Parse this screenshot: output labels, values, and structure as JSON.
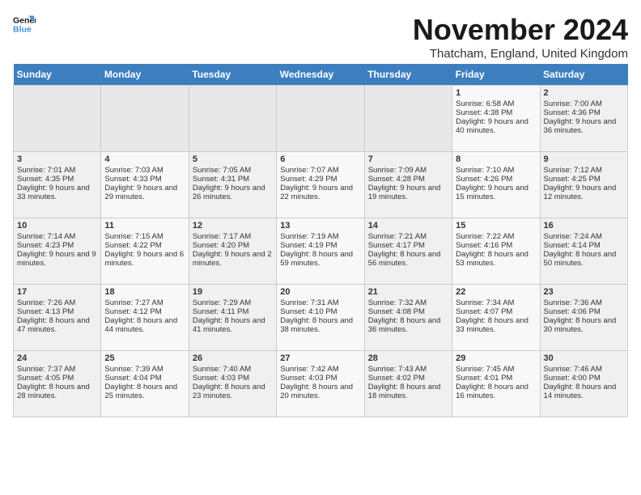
{
  "logo": {
    "line1": "General",
    "line2": "Blue"
  },
  "title": "November 2024",
  "subtitle": "Thatcham, England, United Kingdom",
  "headers": [
    "Sunday",
    "Monday",
    "Tuesday",
    "Wednesday",
    "Thursday",
    "Friday",
    "Saturday"
  ],
  "weeks": [
    [
      {
        "day": "",
        "info": ""
      },
      {
        "day": "",
        "info": ""
      },
      {
        "day": "",
        "info": ""
      },
      {
        "day": "",
        "info": ""
      },
      {
        "day": "",
        "info": ""
      },
      {
        "day": "1",
        "info": "Sunrise: 6:58 AM\nSunset: 4:38 PM\nDaylight: 9 hours and 40 minutes."
      },
      {
        "day": "2",
        "info": "Sunrise: 7:00 AM\nSunset: 4:36 PM\nDaylight: 9 hours and 36 minutes."
      }
    ],
    [
      {
        "day": "3",
        "info": "Sunrise: 7:01 AM\nSunset: 4:35 PM\nDaylight: 9 hours and 33 minutes."
      },
      {
        "day": "4",
        "info": "Sunrise: 7:03 AM\nSunset: 4:33 PM\nDaylight: 9 hours and 29 minutes."
      },
      {
        "day": "5",
        "info": "Sunrise: 7:05 AM\nSunset: 4:31 PM\nDaylight: 9 hours and 26 minutes."
      },
      {
        "day": "6",
        "info": "Sunrise: 7:07 AM\nSunset: 4:29 PM\nDaylight: 9 hours and 22 minutes."
      },
      {
        "day": "7",
        "info": "Sunrise: 7:09 AM\nSunset: 4:28 PM\nDaylight: 9 hours and 19 minutes."
      },
      {
        "day": "8",
        "info": "Sunrise: 7:10 AM\nSunset: 4:26 PM\nDaylight: 9 hours and 15 minutes."
      },
      {
        "day": "9",
        "info": "Sunrise: 7:12 AM\nSunset: 4:25 PM\nDaylight: 9 hours and 12 minutes."
      }
    ],
    [
      {
        "day": "10",
        "info": "Sunrise: 7:14 AM\nSunset: 4:23 PM\nDaylight: 9 hours and 9 minutes."
      },
      {
        "day": "11",
        "info": "Sunrise: 7:15 AM\nSunset: 4:22 PM\nDaylight: 9 hours and 6 minutes."
      },
      {
        "day": "12",
        "info": "Sunrise: 7:17 AM\nSunset: 4:20 PM\nDaylight: 9 hours and 2 minutes."
      },
      {
        "day": "13",
        "info": "Sunrise: 7:19 AM\nSunset: 4:19 PM\nDaylight: 8 hours and 59 minutes."
      },
      {
        "day": "14",
        "info": "Sunrise: 7:21 AM\nSunset: 4:17 PM\nDaylight: 8 hours and 56 minutes."
      },
      {
        "day": "15",
        "info": "Sunrise: 7:22 AM\nSunset: 4:16 PM\nDaylight: 8 hours and 53 minutes."
      },
      {
        "day": "16",
        "info": "Sunrise: 7:24 AM\nSunset: 4:14 PM\nDaylight: 8 hours and 50 minutes."
      }
    ],
    [
      {
        "day": "17",
        "info": "Sunrise: 7:26 AM\nSunset: 4:13 PM\nDaylight: 8 hours and 47 minutes."
      },
      {
        "day": "18",
        "info": "Sunrise: 7:27 AM\nSunset: 4:12 PM\nDaylight: 8 hours and 44 minutes."
      },
      {
        "day": "19",
        "info": "Sunrise: 7:29 AM\nSunset: 4:11 PM\nDaylight: 8 hours and 41 minutes."
      },
      {
        "day": "20",
        "info": "Sunrise: 7:31 AM\nSunset: 4:10 PM\nDaylight: 8 hours and 38 minutes."
      },
      {
        "day": "21",
        "info": "Sunrise: 7:32 AM\nSunset: 4:08 PM\nDaylight: 8 hours and 36 minutes."
      },
      {
        "day": "22",
        "info": "Sunrise: 7:34 AM\nSunset: 4:07 PM\nDaylight: 8 hours and 33 minutes."
      },
      {
        "day": "23",
        "info": "Sunrise: 7:36 AM\nSunset: 4:06 PM\nDaylight: 8 hours and 30 minutes."
      }
    ],
    [
      {
        "day": "24",
        "info": "Sunrise: 7:37 AM\nSunset: 4:05 PM\nDaylight: 8 hours and 28 minutes."
      },
      {
        "day": "25",
        "info": "Sunrise: 7:39 AM\nSunset: 4:04 PM\nDaylight: 8 hours and 25 minutes."
      },
      {
        "day": "26",
        "info": "Sunrise: 7:40 AM\nSunset: 4:03 PM\nDaylight: 8 hours and 23 minutes."
      },
      {
        "day": "27",
        "info": "Sunrise: 7:42 AM\nSunset: 4:03 PM\nDaylight: 8 hours and 20 minutes."
      },
      {
        "day": "28",
        "info": "Sunrise: 7:43 AM\nSunset: 4:02 PM\nDaylight: 8 hours and 18 minutes."
      },
      {
        "day": "29",
        "info": "Sunrise: 7:45 AM\nSunset: 4:01 PM\nDaylight: 8 hours and 16 minutes."
      },
      {
        "day": "30",
        "info": "Sunrise: 7:46 AM\nSunset: 4:00 PM\nDaylight: 8 hours and 14 minutes."
      }
    ]
  ]
}
